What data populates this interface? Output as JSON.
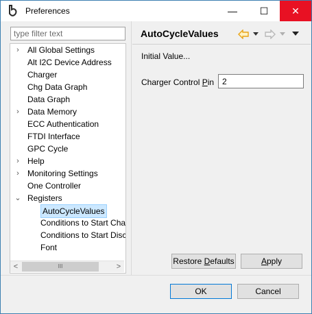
{
  "window": {
    "title": "Preferences",
    "minimize_glyph": "—",
    "maximize_glyph": "☐",
    "close_glyph": "✕"
  },
  "filter": {
    "placeholder": "type filter text",
    "value": ""
  },
  "tree": {
    "items": [
      {
        "label": "All Global Settings",
        "twisty": "›"
      },
      {
        "label": "Alt I2C Device Address",
        "twisty": ""
      },
      {
        "label": "Charger",
        "twisty": ""
      },
      {
        "label": "Chg Data Graph",
        "twisty": ""
      },
      {
        "label": "Data Graph",
        "twisty": ""
      },
      {
        "label": "Data Memory",
        "twisty": "›"
      },
      {
        "label": "ECC Authentication",
        "twisty": ""
      },
      {
        "label": "FTDI Interface",
        "twisty": ""
      },
      {
        "label": "GPC Cycle",
        "twisty": ""
      },
      {
        "label": "Help",
        "twisty": "›"
      },
      {
        "label": "Monitoring Settings",
        "twisty": "›"
      },
      {
        "label": "One Controller",
        "twisty": ""
      },
      {
        "label": "Registers",
        "twisty": "⌄"
      },
      {
        "label": "AutoCycleValues",
        "twisty": "",
        "selected": true
      },
      {
        "label": "Conditions to Start Cha",
        "twisty": ""
      },
      {
        "label": "Conditions to Start Disc",
        "twisty": ""
      },
      {
        "label": "Font",
        "twisty": ""
      }
    ],
    "scroll_left": "<",
    "scroll_right": ">",
    "scroll_grip": "III"
  },
  "page": {
    "title": "AutoCycleValues",
    "initial_value_label": "Initial Value...",
    "pin_label_pre": "Charger Control ",
    "pin_label_mnemonic": "P",
    "pin_label_post": "in",
    "pin_value": "2"
  },
  "buttons": {
    "restore_pre": "Restore ",
    "restore_mnemonic": "D",
    "restore_post": "efaults",
    "apply_mnemonic": "A",
    "apply_post": "pply",
    "ok": "OK",
    "cancel": "Cancel"
  },
  "colors": {
    "close_red": "#e81123",
    "selection_bg": "#cce8ff",
    "back_arrow": "#e8a317"
  }
}
